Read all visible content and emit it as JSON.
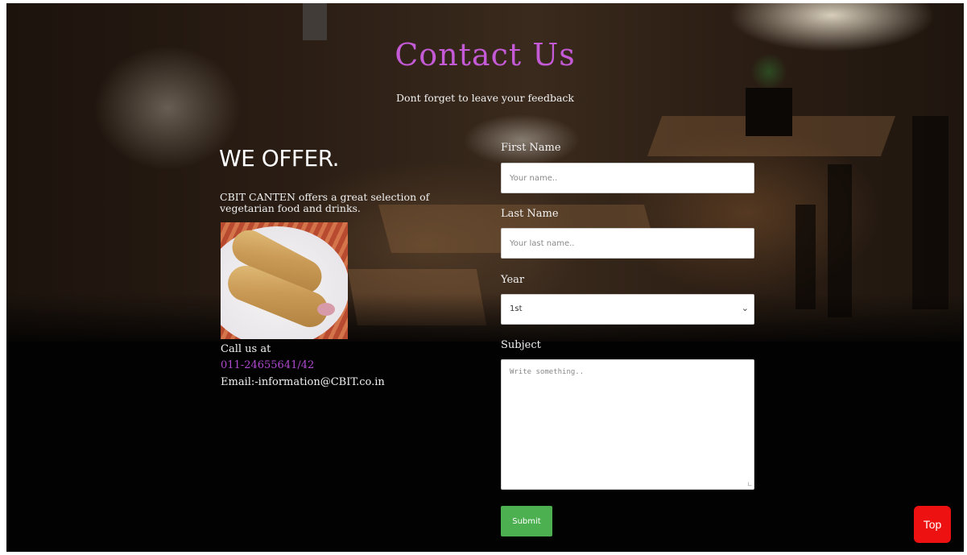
{
  "header": {
    "title": "Contact Us",
    "subtitle": "Dont forget to leave your feedback"
  },
  "offer": {
    "heading": "WE OFFER.",
    "description": "CBIT CANTEN offers a great selection of vegetarian food and drinks.",
    "call_label": "Call us at",
    "phone": "011-24655641/42",
    "email": "Email:-information@CBIT.co.in"
  },
  "form": {
    "first_name_label": "First Name",
    "first_name_placeholder": "Your name..",
    "last_name_label": "Last Name",
    "last_name_placeholder": "Your last name..",
    "year_label": "Year",
    "year_selected": "1st",
    "subject_label": "Subject",
    "subject_placeholder": "Write something..",
    "submit_label": "Submit"
  },
  "top_button": {
    "label": "Top"
  },
  "colors": {
    "title": "#c45ad6",
    "phone": "#b04ad0",
    "submit": "#4caf50",
    "top_button": "#ee1111",
    "background": "#020202"
  },
  "icons": {
    "select_arrow": "chevron-down-icon"
  }
}
